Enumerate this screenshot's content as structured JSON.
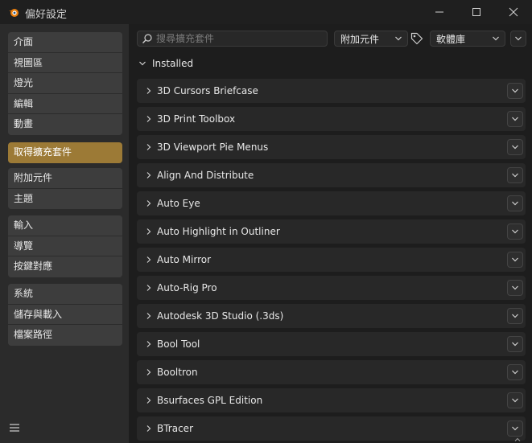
{
  "window": {
    "title": "偏好設定",
    "controls": [
      "minimize",
      "maximize",
      "close"
    ]
  },
  "sidebar": {
    "groups": [
      {
        "items": [
          {
            "label": "介面"
          },
          {
            "label": "視圖區"
          },
          {
            "label": "燈光"
          },
          {
            "label": "編輯"
          },
          {
            "label": "動畫"
          }
        ]
      },
      {
        "items": [
          {
            "label": "取得擴充套件",
            "active": true
          }
        ]
      },
      {
        "items": [
          {
            "label": "附加元件"
          },
          {
            "label": "主題"
          }
        ]
      },
      {
        "items": [
          {
            "label": "輸入"
          },
          {
            "label": "導覽"
          },
          {
            "label": "按鍵對應"
          }
        ]
      },
      {
        "items": [
          {
            "label": "系統"
          },
          {
            "label": "儲存與載入"
          },
          {
            "label": "檔案路徑"
          }
        ]
      }
    ]
  },
  "toolbar": {
    "search_placeholder": "搜尋擴充套件",
    "filter_label": "附加元件",
    "repository_label": "軟體庫"
  },
  "section": {
    "label": "Installed"
  },
  "addons": [
    {
      "name": "3D Cursors Briefcase"
    },
    {
      "name": "3D Print Toolbox"
    },
    {
      "name": "3D Viewport Pie Menus"
    },
    {
      "name": "Align And Distribute"
    },
    {
      "name": "Auto Eye"
    },
    {
      "name": "Auto Highlight in Outliner"
    },
    {
      "name": "Auto Mirror"
    },
    {
      "name": "Auto-Rig Pro"
    },
    {
      "name": "Autodesk 3D Studio (.3ds)"
    },
    {
      "name": "Bool Tool"
    },
    {
      "name": "Booltron"
    },
    {
      "name": "Bsurfaces GPL Edition"
    },
    {
      "name": "BTracer"
    }
  ],
  "colors": {
    "accent": "#9c7a36",
    "panel": "#2b2b2b",
    "row": "#282828",
    "background": "#1d1d1d"
  }
}
